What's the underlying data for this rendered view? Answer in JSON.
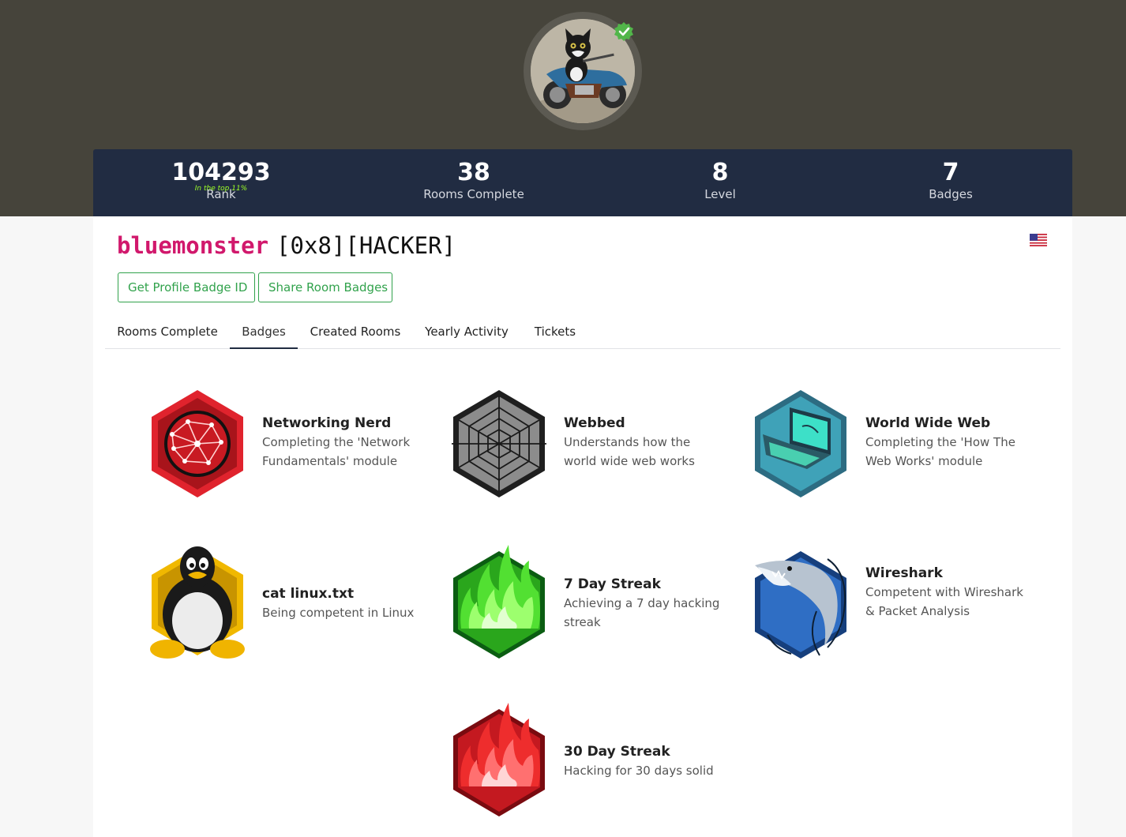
{
  "profile": {
    "avatar_alt": "",
    "username": "bluemonster",
    "tag": "[0x8][HACKER]"
  },
  "stats": {
    "rank": {
      "value": "104293",
      "sub": "In the top 11%",
      "label": "Rank"
    },
    "rooms": {
      "value": "38",
      "label": "Rooms Complete"
    },
    "level": {
      "value": "8",
      "label": "Level"
    },
    "badges": {
      "value": "7",
      "label": "Badges"
    }
  },
  "buttons": {
    "profile_badge": "Get Profile Badge ID",
    "share_badges": "Share Room Badges"
  },
  "tabs": [
    {
      "label": "Rooms Complete",
      "active": false
    },
    {
      "label": "Badges",
      "active": true
    },
    {
      "label": "Created Rooms",
      "active": false
    },
    {
      "label": "Yearly Activity",
      "active": false
    },
    {
      "label": "Tickets",
      "active": false
    }
  ],
  "badges": [
    {
      "title": "Networking Nerd",
      "desc": "Completing the 'Network Fundamentals' module",
      "icon": "network-globe-icon",
      "color": "#d4212b"
    },
    {
      "title": "Webbed",
      "desc": "Understands how the world wide web works",
      "icon": "spider-web-icon",
      "color": "#777777"
    },
    {
      "title": "World Wide Web",
      "desc": "Completing the 'How The Web Works' module",
      "icon": "laptop-web-icon",
      "color": "#2f8aa0"
    },
    {
      "title": "cat linux.txt",
      "desc": "Being competent in Linux",
      "icon": "linux-penguin-icon",
      "color": "#e6a800"
    },
    {
      "title": "7 Day Streak",
      "desc": "Achieving a 7 day hacking streak",
      "icon": "green-fire-icon",
      "color": "#2ea31c"
    },
    {
      "title": "Wireshark",
      "desc": "Competent with Wireshark & Packet Analysis",
      "icon": "wireshark-shark-icon",
      "color": "#1e4f9c"
    },
    {
      "title": "30 Day Streak",
      "desc": "Hacking for 30 days solid",
      "icon": "red-fire-icon",
      "color": "#d4212b"
    }
  ],
  "colors": {
    "header_bg": "#46443b",
    "stats_bg": "#212c42",
    "username": "#d1186c",
    "accent_green": "#31a24c",
    "top_percent": "#9dff26"
  }
}
